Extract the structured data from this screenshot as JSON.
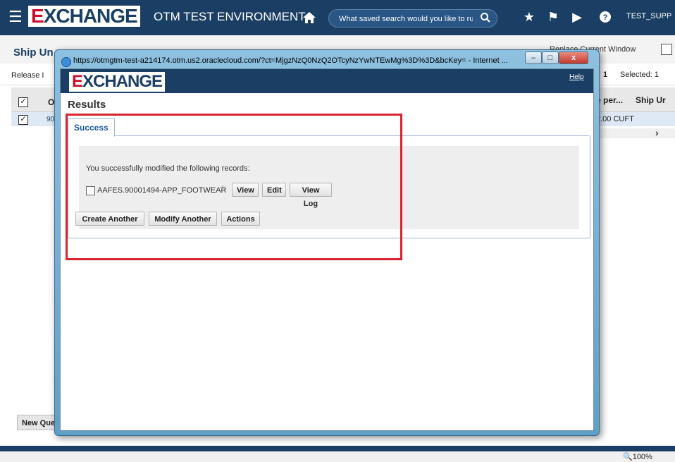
{
  "topbar": {
    "brand": "EXCHANGE",
    "env_title": "OTM TEST ENVIRONMENT",
    "search_placeholder": "What saved search would you like to run?",
    "user": "TEST_SUPP"
  },
  "background": {
    "page_title": "Ship Un",
    "release_label": "Release I",
    "replace_window": "Replace Current Window",
    "count": "1",
    "selected": "Selected: 1",
    "col_per": "e per...",
    "col_ship": "Ship Ur",
    "row_cuft": "2.00 CUFT",
    "col_o": "O",
    "row_90": "90",
    "new_query": "New Que",
    "zoom": "🔍100%"
  },
  "popup": {
    "url": "https://otmgtm-test-a214174.otm.us2.oraclecloud.com/?ct=MjgzNzQ0NzQ2OTcyNzYwNTEwMg%3D%3D&bcKey= - Internet ...",
    "brand": "EXCHANGE",
    "help": "Help",
    "results_title": "Results",
    "tab_success": "Success",
    "message": "You successfully modified the following records:",
    "record": "AAFES.90001494-APP_FOOTWEAR",
    "buttons": {
      "view": "View",
      "edit": "Edit",
      "view_log": "View Log",
      "create_another": "Create Another",
      "modify_another": "Modify Another",
      "actions": "Actions"
    },
    "window_buttons": {
      "minimize": "–",
      "maximize": "□",
      "close": "x"
    }
  },
  "colors": {
    "navy": "#1b3f64",
    "highlight": "#d9232e",
    "brand_red": "#c8102e"
  }
}
